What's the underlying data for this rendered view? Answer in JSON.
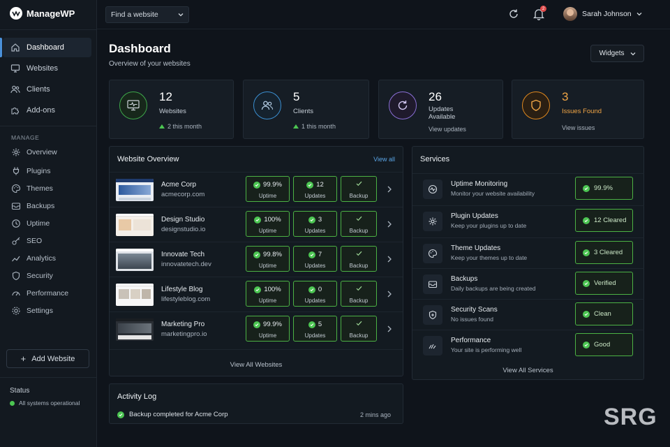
{
  "app": {
    "name": "ManageWP"
  },
  "nav": {
    "main": [
      {
        "label": "Dashboard",
        "icon": "home-icon",
        "active": true
      },
      {
        "label": "Websites",
        "icon": "monitor-icon"
      },
      {
        "label": "Clients",
        "icon": "users-icon"
      },
      {
        "label": "Add-ons",
        "icon": "puzzle-icon"
      }
    ],
    "section_label": "MANAGE",
    "manage": [
      {
        "label": "Overview",
        "icon": "gear-icon"
      },
      {
        "label": "Plugins",
        "icon": "plug-icon"
      },
      {
        "label": "Themes",
        "icon": "palette-icon"
      },
      {
        "label": "Backups",
        "icon": "backup-icon"
      },
      {
        "label": "Uptime",
        "icon": "clock-icon"
      },
      {
        "label": "SEO",
        "icon": "key-icon"
      },
      {
        "label": "Analytics",
        "icon": "analytics-icon"
      },
      {
        "label": "Security",
        "icon": "shield-icon"
      },
      {
        "label": "Performance",
        "icon": "speedometer-icon"
      },
      {
        "label": "Settings",
        "icon": "settings-icon"
      }
    ],
    "add_website": "Add Website",
    "status_title": "Status",
    "status_text": "All systems operational"
  },
  "topbar": {
    "find_placeholder": "Find a website",
    "notification_count": "2",
    "user_name": "Sarah Johnson"
  },
  "page": {
    "title": "Dashboard",
    "subtitle": "Overview of your websites",
    "widgets_label": "Widgets"
  },
  "stats": [
    {
      "value": "12",
      "label": "Websites",
      "footer": "2 this month",
      "color": "#3ea84a",
      "icon": "monitor-pulse-icon"
    },
    {
      "value": "5",
      "label": "Clients",
      "footer": "1 this month",
      "color": "#3b8fd1",
      "icon": "users-icon"
    },
    {
      "value": "26",
      "label": "Updates Available",
      "footer": "View updates",
      "color": "#8a6fd6",
      "icon": "refresh-icon"
    },
    {
      "value": "3",
      "label": "Issues Found",
      "footer": "View issues",
      "color": "#e0891f",
      "icon": "shield-icon"
    }
  ],
  "overview": {
    "title": "Website Overview",
    "view_all": "View all",
    "footer": "View All Websites",
    "uptime_label": "Uptime",
    "updates_label": "Updates",
    "backup_label": "Backup",
    "sites": [
      {
        "name": "Acme Corp",
        "url": "acmecorp.com",
        "uptime": "99.9%",
        "updates": "12"
      },
      {
        "name": "Design Studio",
        "url": "designstudio.io",
        "uptime": "100%",
        "updates": "3"
      },
      {
        "name": "Innovate Tech",
        "url": "innovatetech.dev",
        "uptime": "99.8%",
        "updates": "7"
      },
      {
        "name": "Lifestyle Blog",
        "url": "lifestyleblog.com",
        "uptime": "100%",
        "updates": "0"
      },
      {
        "name": "Marketing Pro",
        "url": "marketingpro.io",
        "uptime": "99.9%",
        "updates": "5"
      }
    ]
  },
  "services": {
    "title": "Services",
    "footer": "View All Services",
    "items": [
      {
        "name": "Uptime Monitoring",
        "desc": "Monitor your website availability",
        "status": "99.9%",
        "icon": "pulse-icon"
      },
      {
        "name": "Plugin Updates",
        "desc": "Keep your plugins up to date",
        "status": "12 Cleared",
        "icon": "gear-icon"
      },
      {
        "name": "Theme Updates",
        "desc": "Keep your themes up to date",
        "status": "3 Cleared",
        "icon": "palette-icon"
      },
      {
        "name": "Backups",
        "desc": "Daily backups are being created",
        "status": "Verified",
        "icon": "inbox-icon"
      },
      {
        "name": "Security Scans",
        "desc": "No issues found",
        "status": "Clean",
        "icon": "shield-plus-icon"
      },
      {
        "name": "Performance",
        "desc": "Your site is performing well",
        "status": "Good",
        "icon": "speed-icon"
      }
    ]
  },
  "activity": {
    "title": "Activity Log",
    "items": [
      {
        "text": "Backup completed for Acme Corp",
        "time": "2 mins ago"
      }
    ]
  },
  "watermark": "SRG"
}
